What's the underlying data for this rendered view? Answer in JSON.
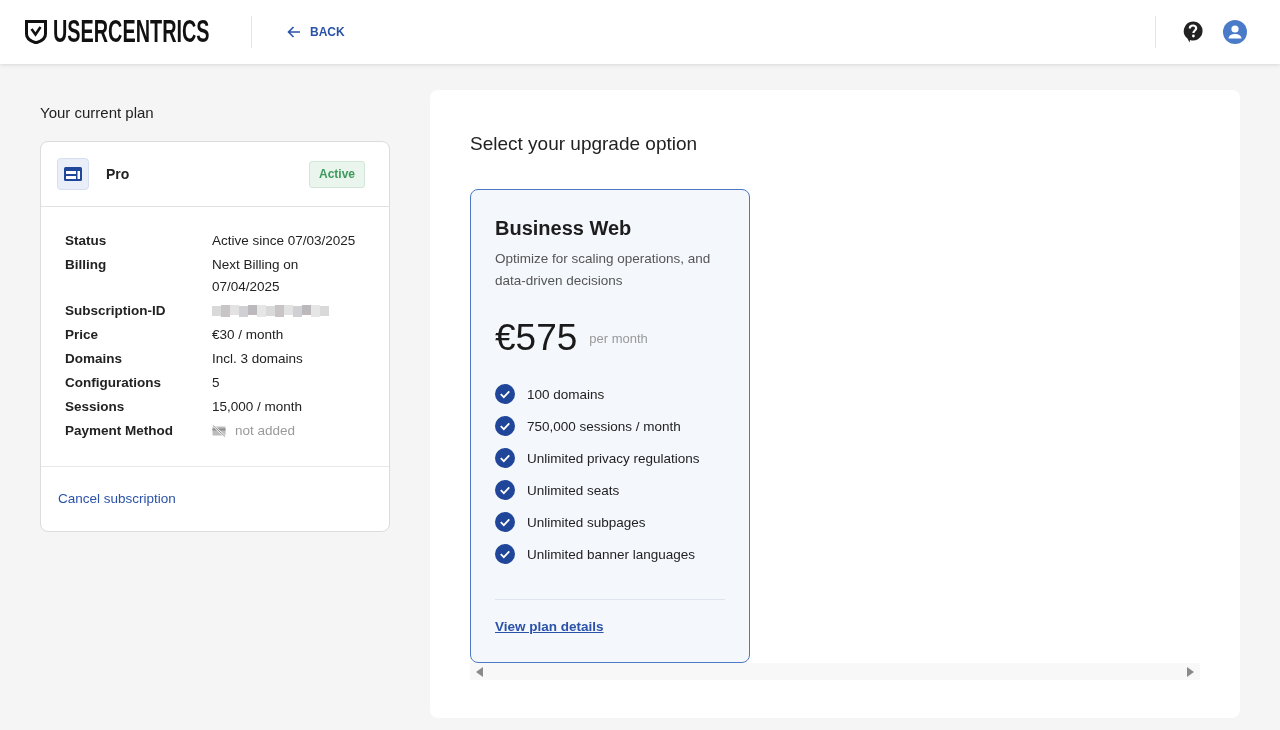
{
  "header": {
    "logo": "USERCENTRICS",
    "back_link": "BACK"
  },
  "current_plan": {
    "heading": "Your current plan",
    "plan_name": "Pro",
    "status_badge": "Active",
    "details": [
      {
        "label": "Status",
        "kind": "text",
        "value": "Active since 07/03/2025"
      },
      {
        "label": "Billing",
        "kind": "text",
        "value": "Next Billing on 07/04/2025"
      },
      {
        "label": "Subscription-ID",
        "kind": "redacted"
      },
      {
        "label": "Price",
        "kind": "text",
        "value": "€30 / month"
      },
      {
        "label": "Domains",
        "kind": "text",
        "value": "Incl. 3 domains"
      },
      {
        "label": "Configurations",
        "kind": "text",
        "value": "5"
      },
      {
        "label": "Sessions",
        "kind": "text",
        "value": "15,000 / month"
      },
      {
        "label": "Payment Method",
        "kind": "missing",
        "value": "not added"
      }
    ],
    "cancel_link": "Cancel subscription"
  },
  "upgrade": {
    "heading": "Select your upgrade option",
    "plans": [
      {
        "name": "Business Web",
        "description": "Optimize for scaling operations, and data-driven decisions",
        "price": "€575",
        "period": "per month",
        "features": [
          "100 domains",
          "750,000 sessions / month",
          "Unlimited privacy regulations",
          "Unlimited seats",
          "Unlimited subpages",
          "Unlimited banner languages"
        ],
        "details_link": "View plan details"
      }
    ]
  }
}
